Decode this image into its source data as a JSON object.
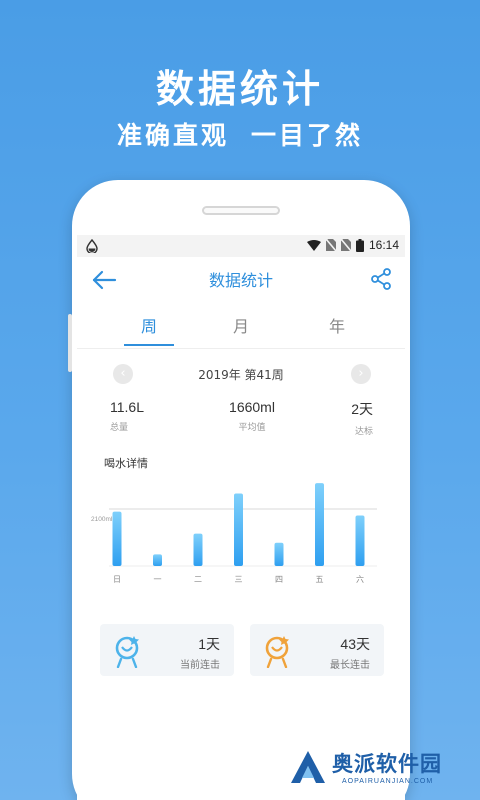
{
  "hero": {
    "title": "数据统计",
    "subtitle_left": "准确直观",
    "subtitle_right": "一目了然"
  },
  "status_bar": {
    "time": "16:14"
  },
  "app": {
    "title": "数据统计",
    "back_icon": "arrow-left-icon",
    "share_icon": "share-icon"
  },
  "tabs": [
    {
      "label": "周",
      "active": true
    },
    {
      "label": "月",
      "active": false
    },
    {
      "label": "年",
      "active": false
    }
  ],
  "week_nav": {
    "label": "2019年 第41周",
    "prev_icon": "chevron-left-icon",
    "next_icon": "chevron-right-icon"
  },
  "summary": [
    {
      "value": "11.6L",
      "label": "总量"
    },
    {
      "value": "1660ml",
      "label": "平均值"
    },
    {
      "value": "2天",
      "label": "达标"
    }
  ],
  "section_title": "喝水详情",
  "chart_data": {
    "type": "bar",
    "categories": [
      "日",
      "一",
      "二",
      "三",
      "四",
      "五",
      "六"
    ],
    "values": [
      2100,
      450,
      1250,
      2800,
      900,
      3200,
      1950
    ],
    "reference_line": {
      "label": "2100ml",
      "value": 2200
    },
    "ylim": [
      0,
      3400
    ],
    "bar_color_top": "#7fd0fb",
    "bar_color_bottom": "#2e9ff0"
  },
  "cards": [
    {
      "value": "1天",
      "label": "当前连击",
      "color": "#4db3ea",
      "icon": "streak-current-icon"
    },
    {
      "value": "43天",
      "label": "最长连击",
      "color": "#f0a23a",
      "icon": "streak-longest-icon"
    }
  ],
  "watermark": {
    "name": "奥派软件园",
    "url": "AOPAIRUANJIAN.COM"
  },
  "colors": {
    "accent": "#2f8fdc",
    "background_top": "#4a9de6",
    "background_bottom": "#6fb3ef"
  }
}
